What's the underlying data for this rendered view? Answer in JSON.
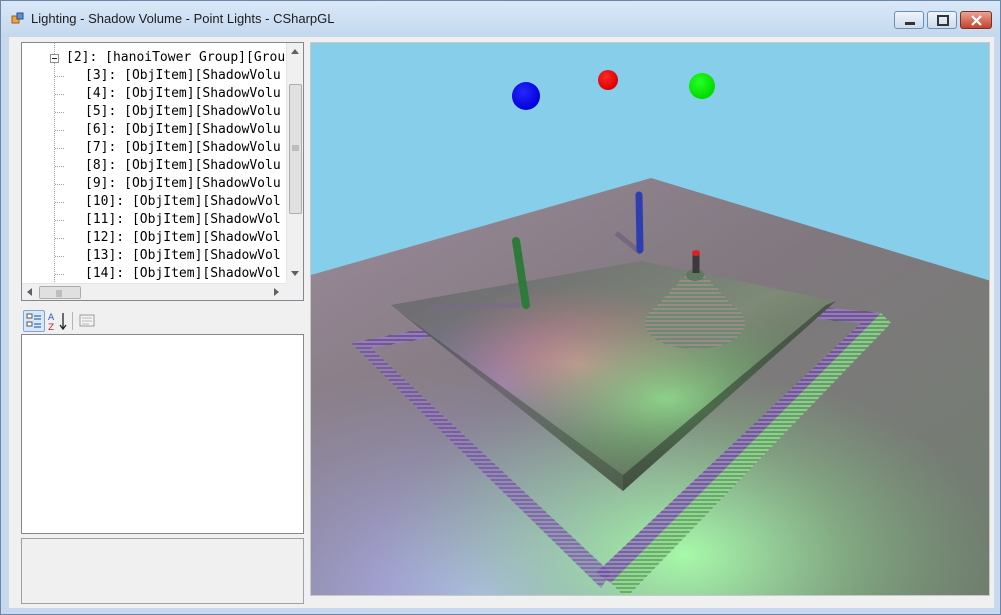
{
  "window": {
    "title": "Lighting - Shadow Volume - Point Lights - CSharpGL"
  },
  "tree": {
    "items": [
      "[2]: [hanoiTower Group][Grou",
      "[3]: [ObjItem][ShadowVolu",
      "[4]: [ObjItem][ShadowVolu",
      "[5]: [ObjItem][ShadowVolu",
      "[6]: [ObjItem][ShadowVolu",
      "[7]: [ObjItem][ShadowVolu",
      "[8]: [ObjItem][ShadowVolu",
      "[9]: [ObjItem][ShadowVolu",
      "[10]: [ObjItem][ShadowVol",
      "[11]: [ObjItem][ShadowVol",
      "[12]: [ObjItem][ShadowVol",
      "[13]: [ObjItem][ShadowVol",
      "[14]: [ObjItem][ShadowVol"
    ]
  },
  "property_grid": {
    "categorized_label": "Categorized",
    "alphabetical_label": "A-Z",
    "property_pages_label": "Property Pages"
  },
  "scene": {
    "background_color": "#87ceeb",
    "light_colors": [
      "#0000ff",
      "#ff0000",
      "#00ff00"
    ]
  }
}
